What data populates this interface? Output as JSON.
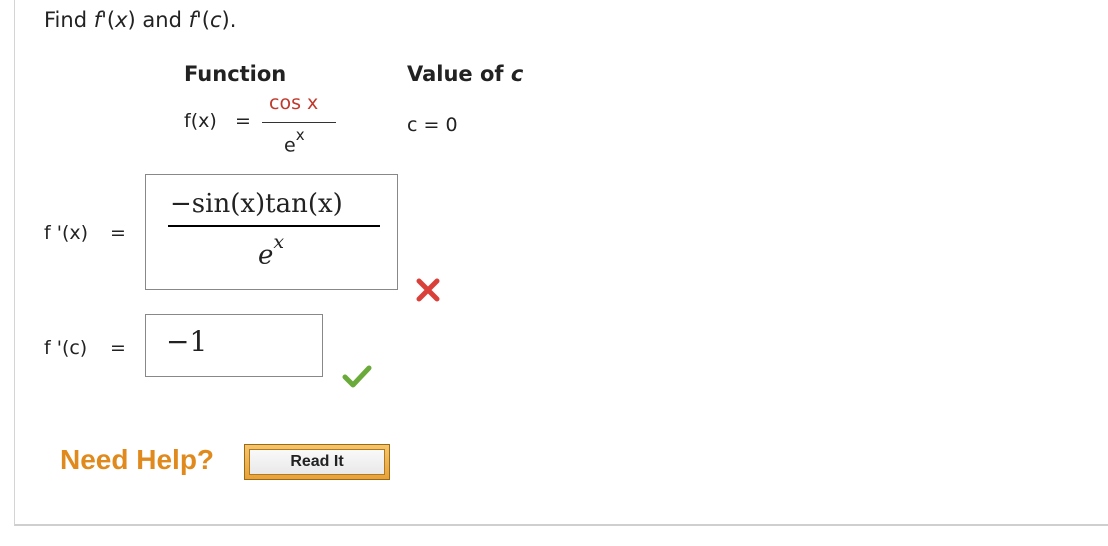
{
  "prompt": {
    "text_find": "Find ",
    "f1": "f",
    "p1": "'(",
    "x1": "x",
    "close1": ")",
    "and": " and ",
    "f2": "f",
    "p2": "'(",
    "c1": "c",
    "close2": ")."
  },
  "headers": {
    "function": "Function",
    "value_of": "Value of ",
    "c": "c"
  },
  "function_def": {
    "lhs": "f(x)",
    "equals": "=",
    "numerator": "cos x",
    "denominator_base": "e",
    "denominator_exp": "x"
  },
  "c_value": "c = 0",
  "rows": {
    "fprime_x_label": "f '(x)",
    "fprime_c_label": "f '(c)",
    "equals": "="
  },
  "answers": {
    "fprime_x_numerator": "−sin(x)tan(x)",
    "fprime_x_den_base": "e",
    "fprime_x_den_exp": "x",
    "fprime_c_value": "−1",
    "fprime_x_status": "incorrect",
    "fprime_c_status": "correct"
  },
  "help": {
    "label": "Need Help?",
    "read_it": "Read It"
  },
  "colors": {
    "red_text": "#c0392b",
    "help_orange": "#e08a1e",
    "incorrect_red": "#d9403a",
    "correct_green": "#6aaa3a"
  },
  "icons": {
    "incorrect": "cross-icon",
    "correct": "check-icon"
  }
}
